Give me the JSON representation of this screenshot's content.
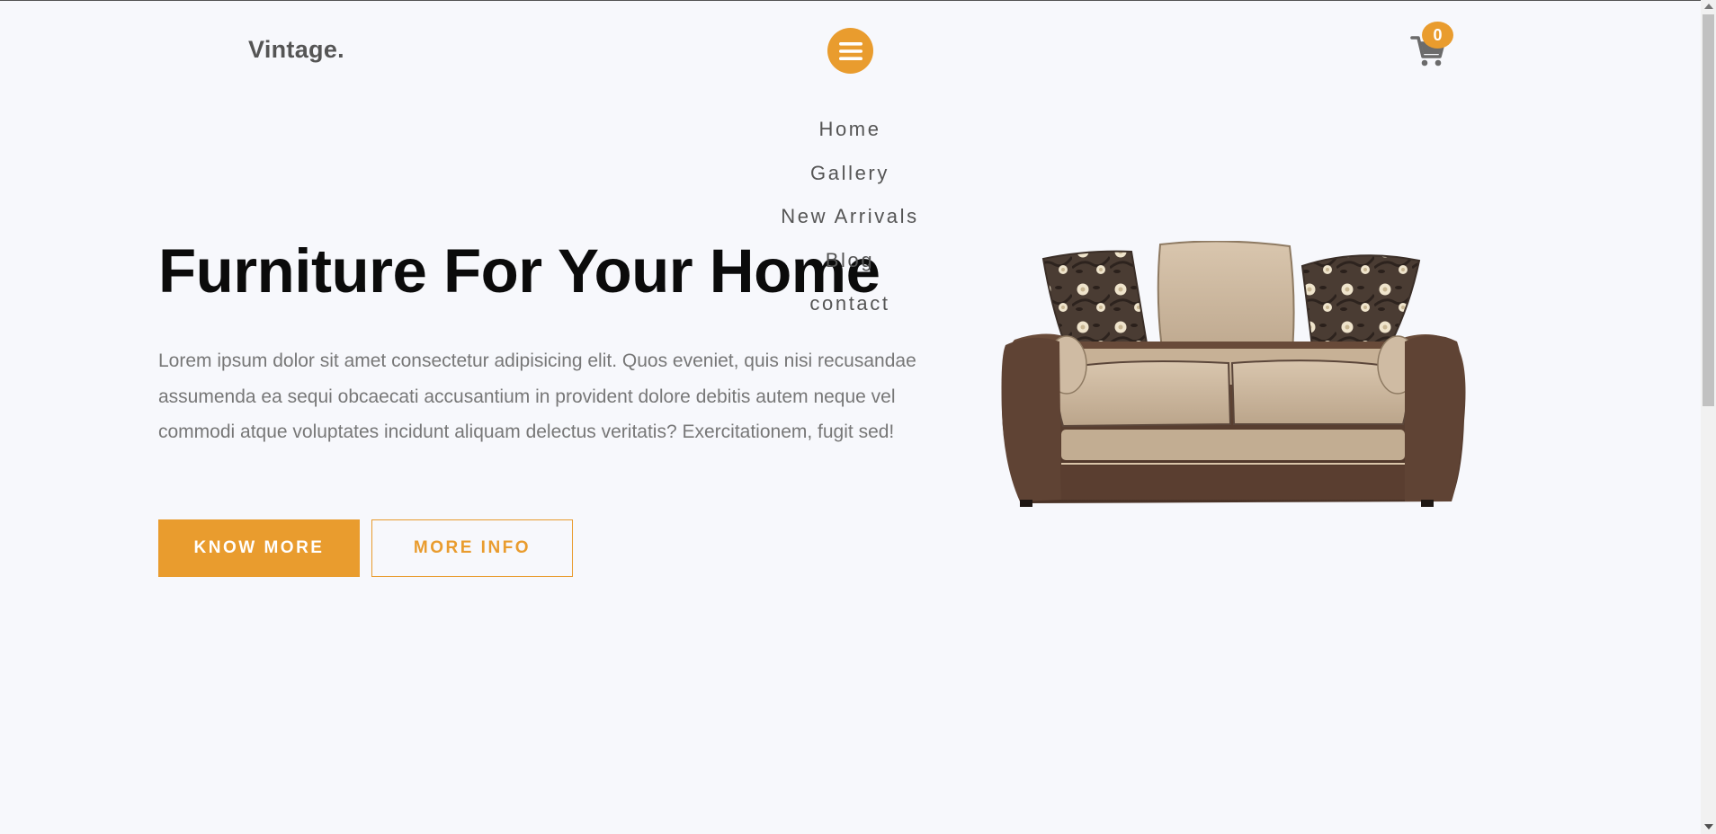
{
  "header": {
    "logo": "Vintage.",
    "cart_count": "0"
  },
  "nav": {
    "items": [
      "Home",
      "Gallery",
      "New Arrivals",
      "Blog",
      "contact"
    ]
  },
  "hero": {
    "title": "Furniture For Your Home",
    "text": "Lorem ipsum dolor sit amet consectetur adipisicing elit. Quos eveniet, quis nisi recusandae assumenda ea sequi obcaecati accusantium in provident dolore debitis autem neque vel commodi atque voluptates incidunt aliquam delectus veritatis? Exercitationem, fugit sed!",
    "primary_button": "KNOW MORE",
    "secondary_button": "MORE INFO"
  },
  "icons": {
    "menu": "hamburger-menu-icon",
    "cart": "shopping-cart-icon",
    "product": "sofa-image"
  },
  "colors": {
    "accent": "#e99c2e",
    "background": "#f7f8fc",
    "text_dark": "#0b0b0b",
    "text_muted": "#777777",
    "text_nav": "#555555"
  }
}
